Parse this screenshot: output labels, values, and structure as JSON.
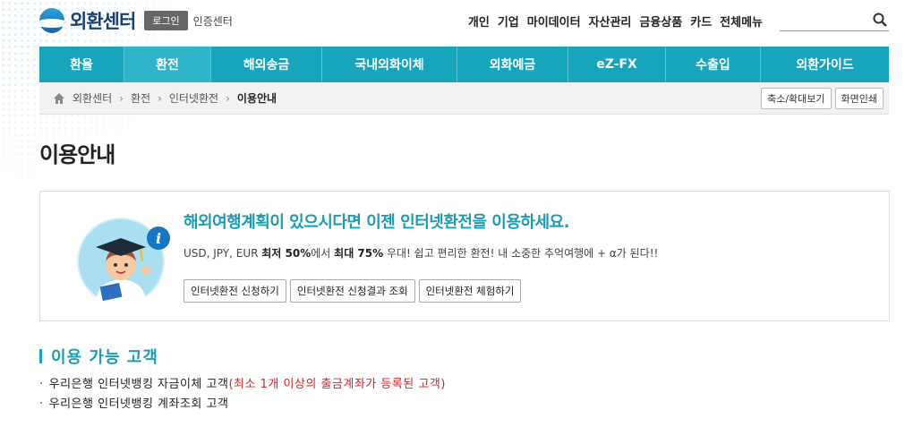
{
  "header": {
    "logo_text": "외환센터",
    "login_label": "로그인",
    "cert_label": "인증센터",
    "top_menu": [
      "개인",
      "기업",
      "마이데이터",
      "자산관리",
      "금융상품",
      "카드",
      "전체메뉴"
    ],
    "search_placeholder": ""
  },
  "gnb": {
    "items": [
      "환율",
      "환전",
      "해외송금",
      "국내외화이체",
      "외화예금",
      "eZ-FX",
      "수출입",
      "외환가이드"
    ],
    "active": "환전"
  },
  "breadcrumb": {
    "items": [
      "외환센터",
      "환전",
      "인터넷환전",
      "이용안내"
    ],
    "zoom_label": "축소/확대보기",
    "print_label": "화면인쇄"
  },
  "page": {
    "title": "이용안내"
  },
  "info": {
    "headline": "해외여행계획이 있으시다면 이젠 인터넷환전을 이용하세요.",
    "desc_prefix": "USD, JPY, EUR ",
    "desc_min": "최저 50%",
    "desc_mid": "에서 ",
    "desc_max": "최대 75%",
    "desc_suffix": " 우대! 쉽고 편리한 환전! 내 소중한 추억여행에 + α가 된다!!",
    "buttons": [
      "인터넷환전 신청하기",
      "인터넷환전 신청결과 조회",
      "인터넷환전 체험하기"
    ]
  },
  "section": {
    "title": "이용 가능 고객",
    "item1_main": "우리은행 인터넷뱅킹 자금이체 고객",
    "item1_note": "(최소 1개 이상의 출금계좌가 등록된 고객)",
    "item2": "우리은행 인터넷뱅킹 계좌조회 고객"
  },
  "colors": {
    "accent": "#17a5bc",
    "headline": "#1a9cb4",
    "note_red": "#d2252b"
  }
}
